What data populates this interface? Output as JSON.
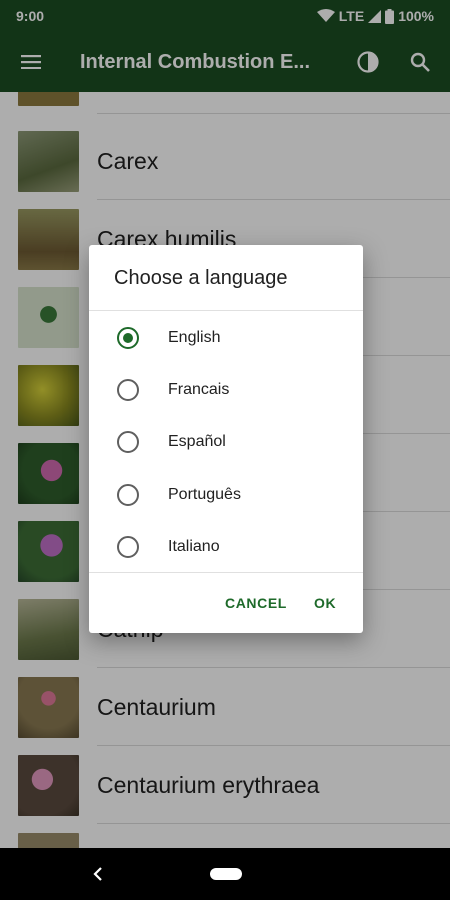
{
  "status_bar": {
    "time": "9:00",
    "network": "LTE",
    "battery": "100%",
    "icons": [
      "wifi-icon",
      "cellular-signal-icon",
      "battery-icon"
    ]
  },
  "app_bar": {
    "title": "Internal Combustion E...",
    "menu_icon": "hamburger-menu-icon",
    "theme_icon": "contrast-icon",
    "search_icon": "search-icon"
  },
  "list": {
    "items": [
      {
        "label": "",
        "thumb_color": "#8c7a3e"
      },
      {
        "label": "Carex",
        "thumb_color": "#6f7a55"
      },
      {
        "label": "Carex humilis",
        "thumb_color": "#7d6f3c"
      },
      {
        "label": "",
        "thumb_color": "#cfdcc4"
      },
      {
        "label": "",
        "thumb_color": "#a9a230"
      },
      {
        "label": "",
        "thumb_color": "#3f6a35"
      },
      {
        "label": "",
        "thumb_color": "#3c6a3a"
      },
      {
        "label": "Catnip",
        "thumb_color": "#7f8a5c"
      },
      {
        "label": "Centaurium",
        "thumb_color": "#7b6a4a"
      },
      {
        "label": "Centaurium erythraea",
        "thumb_color": "#6c5e4f"
      },
      {
        "label": "",
        "thumb_color": "#9a8c6a"
      }
    ]
  },
  "dialog": {
    "title": "Choose a language",
    "options": [
      {
        "label": "English",
        "selected": true
      },
      {
        "label": "Francais",
        "selected": false
      },
      {
        "label": "Español",
        "selected": false
      },
      {
        "label": "Português",
        "selected": false
      },
      {
        "label": "Italiano",
        "selected": false
      }
    ],
    "cancel_label": "CANCEL",
    "ok_label": "OK"
  },
  "nav_bar": {
    "back_icon": "back-chevron-icon",
    "home_icon": "home-pill-icon"
  },
  "colors": {
    "primary_dark": "#1b4d23",
    "accent": "#1e6a2a"
  }
}
